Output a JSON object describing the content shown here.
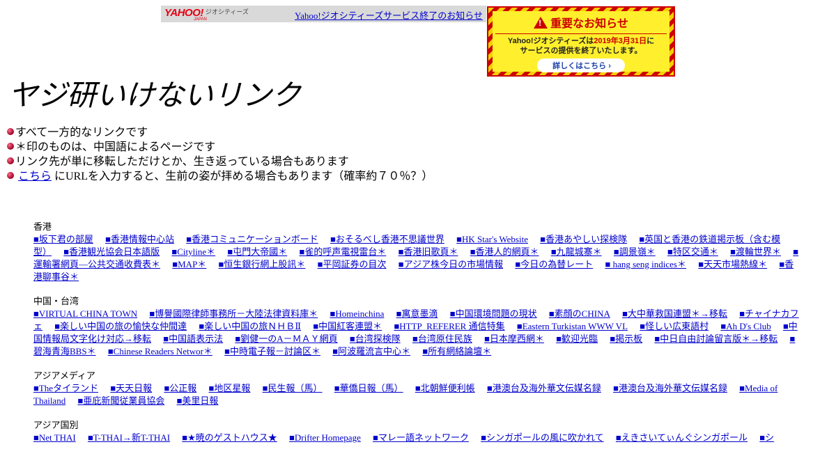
{
  "header": {
    "logo_yahoo": "YAHOO!",
    "logo_japan": "JAPAN",
    "logo_geo": "ジオシティーズ",
    "service_link": "Yahoo!ジオシティーズサービス終了のお知らせ"
  },
  "notice": {
    "title": "重要なお知らせ",
    "line1_pre": "Yahoo!ジオシティーズは",
    "line1_date": "2019年3月31日",
    "line1_post": "に",
    "line2": "サービスの提供を終了いたします。",
    "button": "詳しくはこちら ›"
  },
  "page": {
    "title": "ヤジ研いけないリンク"
  },
  "notes": [
    "すべて一方的なリンクです",
    "＊印のものは、中国語によるページです",
    "リンク先が単に移転しただけとか、生き返っている場合もあります"
  ],
  "note4": {
    "link": "こちら",
    "text": "にURLを入力すると、生前の姿が拝める場合もあります（確率約７０％？）"
  },
  "sections": [
    {
      "title": "香港",
      "links": [
        "■坂下君の部屋",
        "■香港情報中心站",
        "■香港コミュニケーションボード",
        "■おそるべし香港不思議世界",
        "■HK Star's Website",
        "■香港あやしい探検隊",
        "■英国と香港の鉄道掲示板（含む模型）",
        "■香港観光協会日本語版",
        "■Cityline＊",
        "■屯門大帝國＊",
        "■雀的呼声電視雷台＊",
        "■香港旧歌頁＊",
        "■香港人的網頁＊",
        "■九龍城寨＊",
        "■調景嶺＊",
        "■特区交通＊",
        "■渡輪世界＊",
        "■運輸署網頁—公共交通收費表＊",
        "■MAP＊",
        "■恒生銀行網上股訊＊",
        "■平岡証券の目次",
        "■アジア株今日の市場情報",
        "■今日の為替レート",
        "■ hang seng indices＊",
        "■天天市場熱線＊",
        "■香港聊事谷＊"
      ]
    },
    {
      "title": "中国・台湾",
      "links": [
        "■VIRTUAL CHINA TOWN",
        "■博譽國際律師事務所－大陸法律資料庫＊",
        "■Homeinchina",
        "■寓意墨滴",
        "■中国環境問題の現状",
        "■素顔のCHINA",
        "■大中華救国連盟＊→移転",
        "■チャイナカフェ",
        "■楽しい中国の旅の愉快な仲間達",
        "■楽しい中国の旅ＮＨＢⅡ",
        "■中国紅客連盟＊",
        "■HTTP_REFERER 通信特集",
        "■Eastern Turkistan WWW VL",
        "■怪しい広東語村",
        "■Ah D's Club",
        "■中国情報局文字化け対応→移転",
        "■中国語表示法",
        "■劉健一のA－ＭＡＹ網頁",
        "■台湾探検隊",
        "■台湾原住民族",
        "■日本摩西網＊",
        "■歓迎光臨",
        "■掲示板",
        "■中日自由討論留言版＊→移転",
        "■碧海青海BBS＊",
        "■Chinese Readers Networ＊",
        "■中時電子報－討論区＊",
        "■阿波羅流言中心＊",
        "■所有網絡論壇＊"
      ]
    },
    {
      "title": "アジアメディア",
      "links": [
        "■Theタイランド",
        "■天天日報",
        "■公正報",
        "■地区星報",
        "■民生報（馬）",
        "■華僑日報（馬）",
        "■北朝鮮便利帳",
        "■港澳台及海外華文伝媒名録",
        "■港澳台及海外華文伝媒名録",
        "■Media of Thailand",
        "■亜庇新聞従業員協会",
        "■美里日報"
      ]
    },
    {
      "title": "アジア国別",
      "links": [
        "■Net THAI",
        "■T-THAI→新T-THAI",
        "■★暁のゲストハウス★",
        "■Drifter Homepage",
        "■マレー語ネットワーク",
        "■シンガポールの風に吹かれて",
        "■えきさいてぃんぐシンガポール",
        "■シ"
      ]
    }
  ]
}
